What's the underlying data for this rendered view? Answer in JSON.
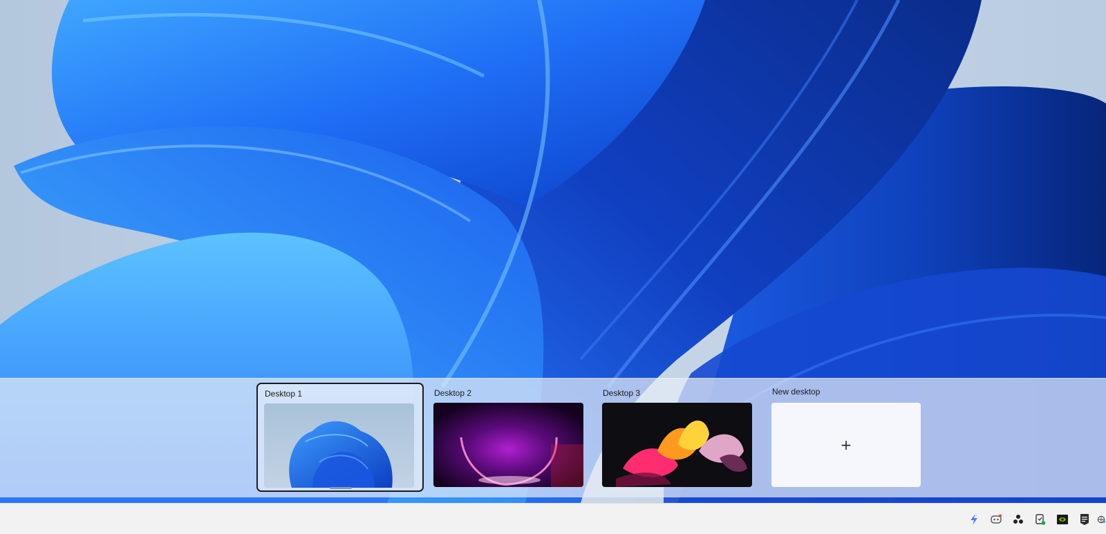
{
  "task_view": {
    "desktops": [
      {
        "label": "Desktop 1",
        "selected": true,
        "wallpaper": "blue-bloom"
      },
      {
        "label": "Desktop 2",
        "selected": false,
        "wallpaper": "purple-glow"
      },
      {
        "label": "Desktop 3",
        "selected": false,
        "wallpaper": "colorful-ribbons"
      }
    ],
    "new_desktop": {
      "label": "New desktop",
      "icon": "plus-icon",
      "glyph": "+"
    }
  },
  "taskbar": {
    "tray_icons": [
      {
        "name": "lightning-app-icon",
        "color": "#4f7cff"
      },
      {
        "name": "discord-icon",
        "color": "#5a5a5a"
      },
      {
        "name": "davinci-resolve-icon",
        "color": "#222222"
      },
      {
        "name": "file-sync-icon",
        "color": "#3a3a3a"
      },
      {
        "name": "nvidia-icon",
        "color": "#76b900"
      },
      {
        "name": "epic-games-icon",
        "color": "#2b2b2b"
      },
      {
        "name": "network-overflow-icon",
        "color": "#444444"
      }
    ]
  }
}
